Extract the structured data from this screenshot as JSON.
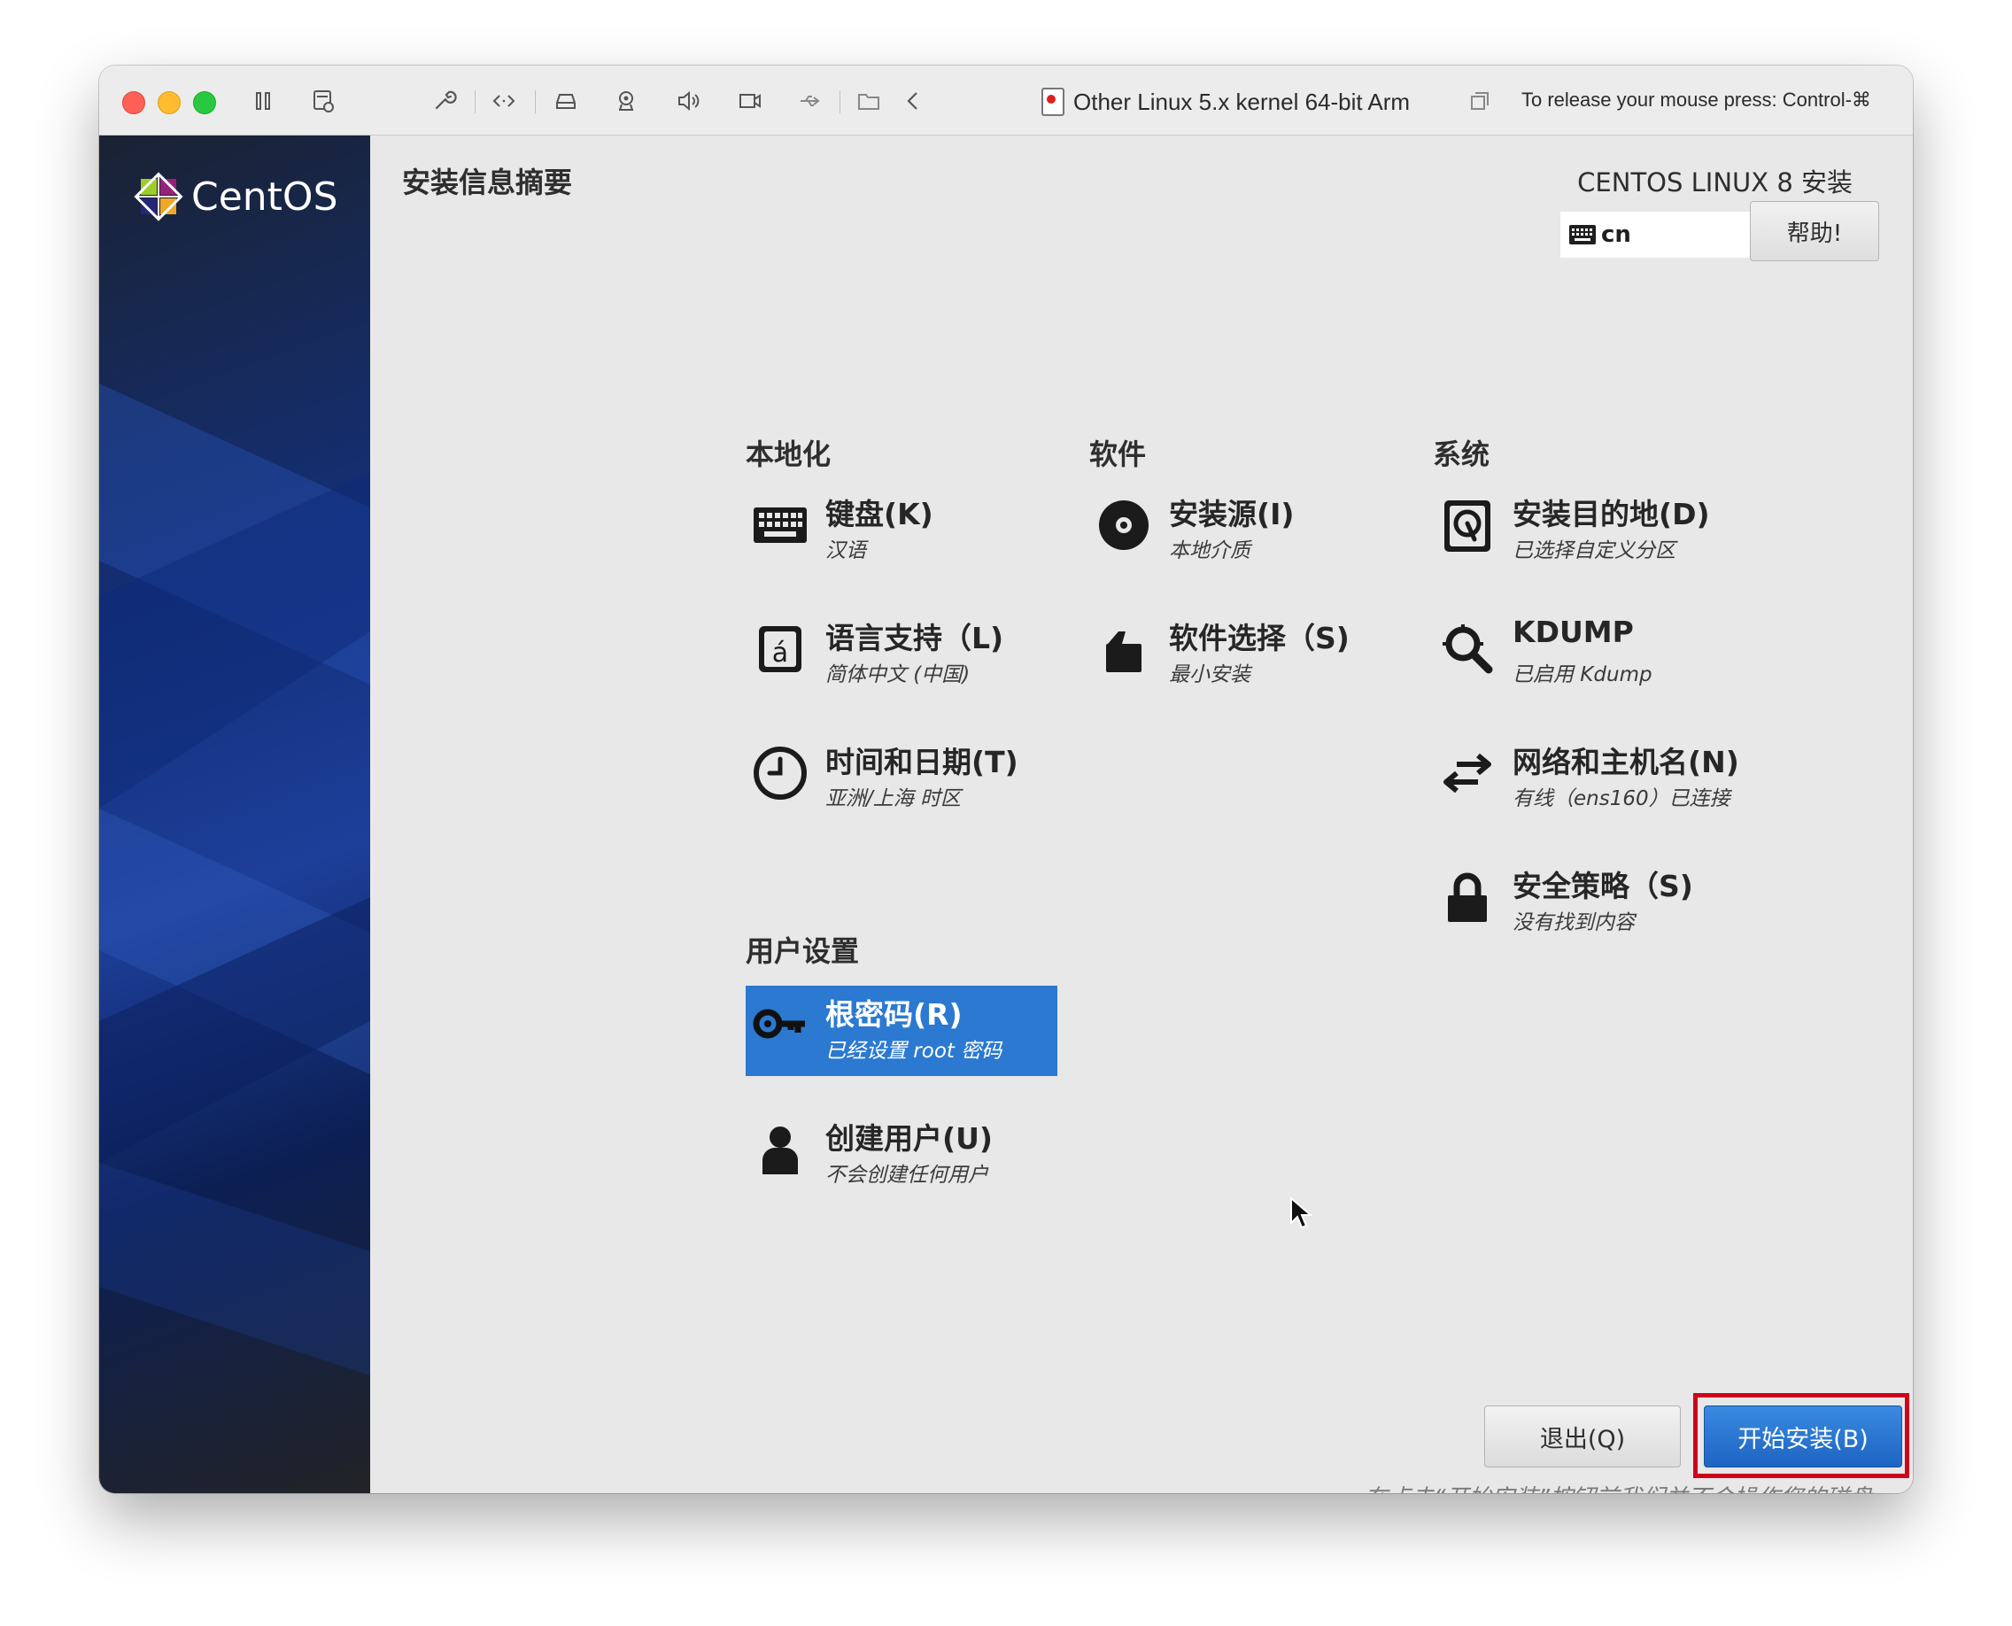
{
  "vm_window": {
    "title": "Other Linux 5.x kernel 64-bit Arm",
    "release_hint": "To release your mouse press: Control-⌘",
    "toolbar_icons": [
      "pause-icon",
      "snapshot-icon",
      "wrench-icon",
      "code-icon",
      "drive-icon",
      "camera-icon",
      "speaker-icon",
      "video-icon",
      "usb-icon",
      "shared-folder-icon",
      "back-icon",
      "fullscreen-icon"
    ]
  },
  "installer": {
    "logo_text": "CentOS",
    "spoke_title": "安装信息摘要",
    "product_title": "CENTOS LINUX 8 安装",
    "keyboard_layout": "cn",
    "help_label": "帮助!",
    "categories": {
      "localization": "本地化",
      "software": "软件",
      "system": "系统",
      "user_settings": "用户设置"
    },
    "spokes": {
      "keyboard": {
        "title": "键盘(K)",
        "status": "汉语",
        "icon": "keyboard-icon"
      },
      "language": {
        "title": "语言支持（L)",
        "status": "简体中文 (中国)",
        "icon": "language-icon"
      },
      "datetime": {
        "title": "时间和日期(T)",
        "status": "亚洲/上海 时区",
        "icon": "clock-icon"
      },
      "source": {
        "title": "安装源(I)",
        "status": "本地介质",
        "icon": "disc-icon"
      },
      "software": {
        "title": "软件选择（S)",
        "status": "最小安装",
        "icon": "package-icon"
      },
      "destination": {
        "title": "安装目的地(D)",
        "status": "已选择自定义分区",
        "icon": "hard-drive-icon"
      },
      "kdump": {
        "title": "KDUMP",
        "status": "已启用 Kdump",
        "icon": "search-icon"
      },
      "network": {
        "title": "网络和主机名(N)",
        "status": "有线（ens160）已连接",
        "icon": "network-arrows-icon"
      },
      "security": {
        "title": "安全策略（S)",
        "status": "没有找到内容",
        "icon": "lock-icon"
      },
      "root": {
        "title": "根密码(R)",
        "status": "已经设置 root 密码",
        "icon": "key-icon"
      },
      "user": {
        "title": "创建用户(U)",
        "status": "不会创建任何用户",
        "icon": "user-icon"
      }
    },
    "quit_label": "退出(Q)",
    "begin_label": "开始安装(B)",
    "warning_text": "在点击“开始安装”按钮前我们并不会操作您的磁盘。"
  },
  "colors": {
    "selected_spoke": "#2b79d1",
    "begin_button": "#1d64c2",
    "highlight_box": "#d0021b"
  }
}
